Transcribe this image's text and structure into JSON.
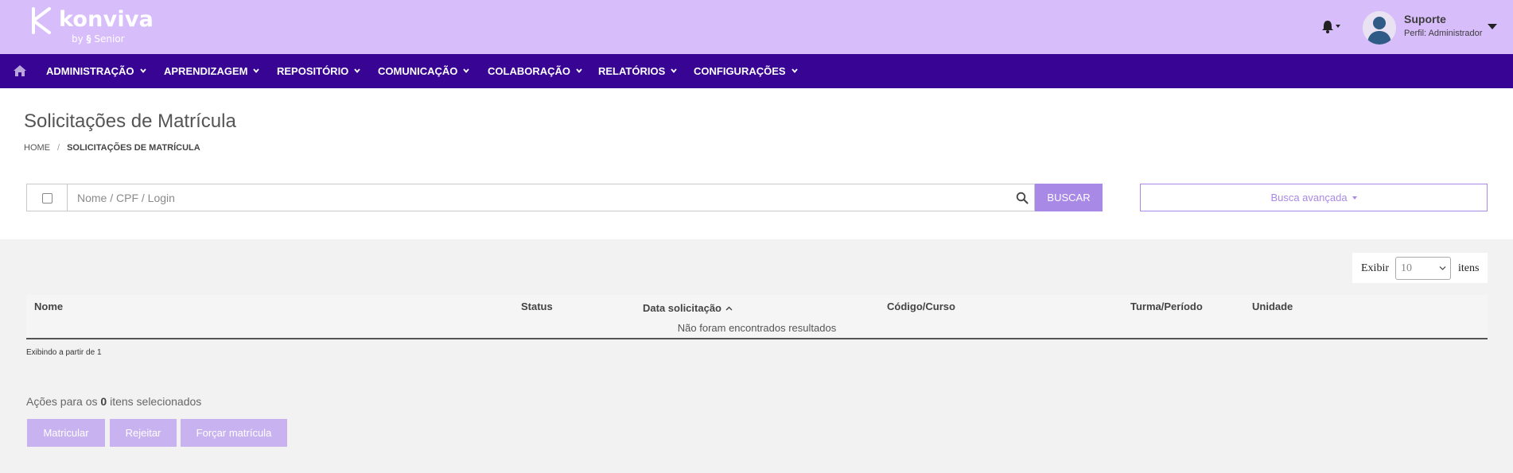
{
  "header": {
    "brand": "konviva",
    "brand_by": "by",
    "brand_sub": "Senior",
    "user": {
      "name": "Suporte",
      "profile": "Perfil: Administrador"
    }
  },
  "nav": {
    "items": [
      {
        "label": "ADMINISTRAÇÃO"
      },
      {
        "label": "APRENDIZAGEM"
      },
      {
        "label": "REPOSITÓRIO"
      },
      {
        "label": "COMUNICAÇÃO"
      },
      {
        "label": "COLABORAÇÃO"
      },
      {
        "label": "RELATÓRIOS"
      },
      {
        "label": "CONFIGURAÇÕES"
      }
    ]
  },
  "page": {
    "title": "Solicitações de Matrícula",
    "breadcrumb": {
      "home": "HOME",
      "separator": "/",
      "current": "SOLICITAÇÕES DE MATRÍCULA"
    }
  },
  "search": {
    "placeholder": "Nome / CPF / Login",
    "button": "BUSCAR",
    "advanced": "Busca avançada"
  },
  "pager": {
    "show_label": "Exibir",
    "value": "10",
    "suffix": "itens"
  },
  "table": {
    "columns": [
      "Nome",
      "Status",
      "Data solicitação",
      "Código/Curso",
      "Turma/Período",
      "Unidade"
    ],
    "empty": "Não foram encontrados resultados",
    "showing": "Exibindo a partir de 1"
  },
  "actions": {
    "prefix": "Ações para os",
    "count": "0",
    "suffix": "itens selecionados",
    "buttons": [
      "Matricular",
      "Rejeitar",
      "Forçar matrícula"
    ]
  },
  "colors": {
    "header": "#d8bdfb",
    "nav": "#370494",
    "accent": "#a989e6",
    "action": "#c8b2f0"
  }
}
